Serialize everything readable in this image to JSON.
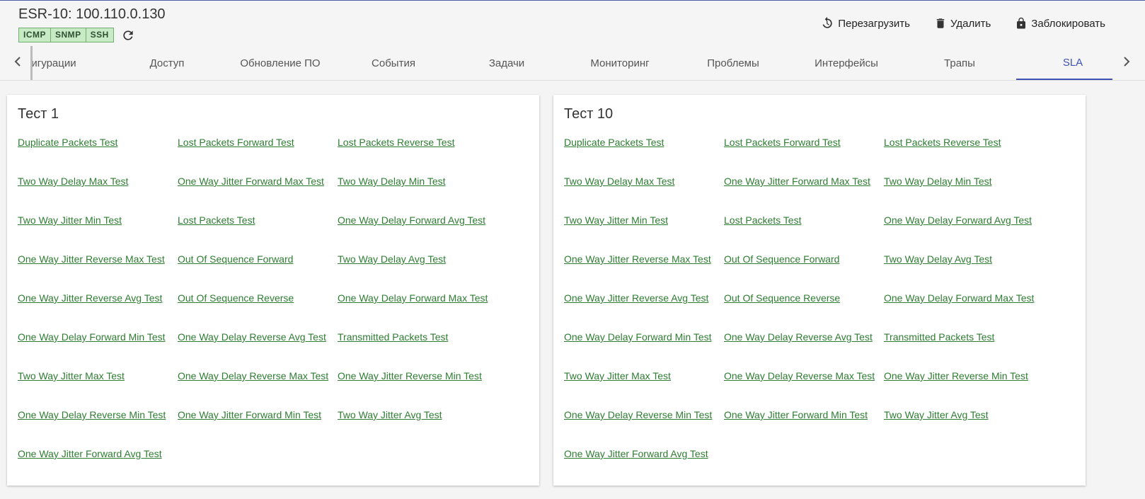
{
  "device": {
    "title": "ESR-10: 100.110.0.130",
    "badges": [
      "ICMP",
      "SNMP",
      "SSH"
    ]
  },
  "actions": {
    "reboot": "Перезагрузить",
    "delete": "Удалить",
    "lock": "Заблокировать"
  },
  "tabs": [
    {
      "label": "игурации"
    },
    {
      "label": "Доступ"
    },
    {
      "label": "Обновление ПО"
    },
    {
      "label": "События"
    },
    {
      "label": "Задачи"
    },
    {
      "label": "Мониторинг"
    },
    {
      "label": "Проблемы"
    },
    {
      "label": "Интерфейсы"
    },
    {
      "label": "Трапы"
    },
    {
      "label": "SLA"
    }
  ],
  "active_tab": "SLA",
  "colors": {
    "accent": "#3f51b5",
    "link": "#2e7d32",
    "badge_bg": "#c8ebc6"
  },
  "cards": [
    {
      "title": "Тест 1",
      "links": [
        "Duplicate Packets Test",
        "Lost Packets Forward Test",
        "Lost Packets Reverse Test",
        "Two Way Delay Max Test",
        "One Way Jitter Forward Max Test",
        "Two Way Delay Min Test",
        "Two Way Jitter Min Test",
        "Lost Packets Test",
        "One Way Delay Forward Avg Test",
        "One Way Jitter Reverse Max Test",
        "Out Of Sequence Forward",
        "Two Way Delay Avg Test",
        "One Way Jitter Reverse Avg Test",
        "Out Of Sequence Reverse",
        "One Way Delay Forward Max Test",
        "One Way Delay Forward Min Test",
        "One Way Delay Reverse Avg Test",
        "Transmitted Packets Test",
        "Two Way Jitter Max Test",
        "One Way Delay Reverse Max Test",
        "One Way Jitter Reverse Min Test",
        "One Way Delay Reverse Min Test",
        "One Way Jitter Forward Min Test",
        "Two Way Jitter Avg Test",
        "One Way Jitter Forward Avg Test"
      ]
    },
    {
      "title": "Тест 10",
      "links": [
        "Duplicate Packets Test",
        "Lost Packets Forward Test",
        "Lost Packets Reverse Test",
        "Two Way Delay Max Test",
        "One Way Jitter Forward Max Test",
        "Two Way Delay Min Test",
        "Two Way Jitter Min Test",
        "Lost Packets Test",
        "One Way Delay Forward Avg Test",
        "One Way Jitter Reverse Max Test",
        "Out Of Sequence Forward",
        "Two Way Delay Avg Test",
        "One Way Jitter Reverse Avg Test",
        "Out Of Sequence Reverse",
        "One Way Delay Forward Max Test",
        "One Way Delay Forward Min Test",
        "One Way Delay Reverse Avg Test",
        "Transmitted Packets Test",
        "Two Way Jitter Max Test",
        "One Way Delay Reverse Max Test",
        "One Way Jitter Reverse Min Test",
        "One Way Delay Reverse Min Test",
        "One Way Jitter Forward Min Test",
        "Two Way Jitter Avg Test",
        "One Way Jitter Forward Avg Test"
      ]
    }
  ]
}
